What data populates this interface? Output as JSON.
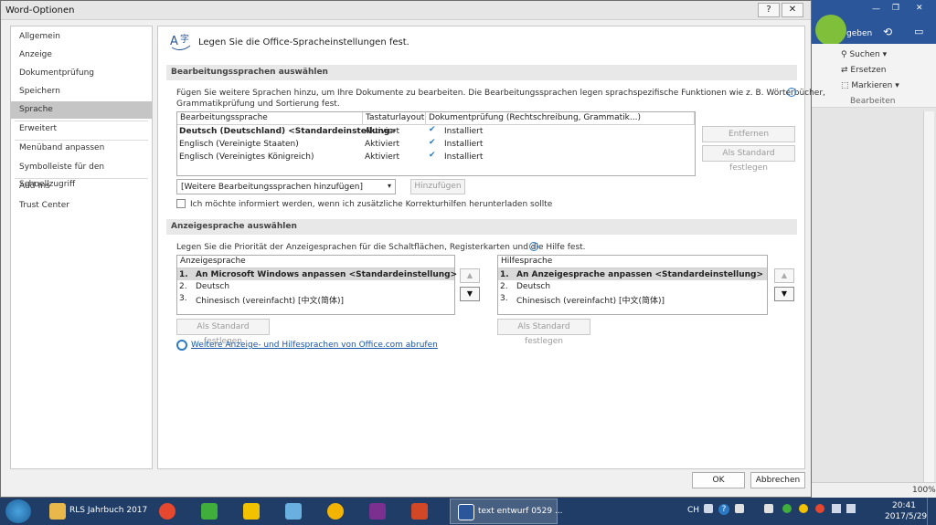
{
  "dialog": {
    "title": "Word-Optionen",
    "help_icon": "?",
    "close_icon": "✕"
  },
  "nav": {
    "items": [
      {
        "label": "Allgemein"
      },
      {
        "label": "Anzeige"
      },
      {
        "label": "Dokumentprüfung"
      },
      {
        "label": "Speichern"
      },
      {
        "label": "Sprache"
      },
      {
        "label": "Erweitert"
      },
      {
        "label": "Menüband anpassen"
      },
      {
        "label": "Symbolleiste für den Schnellzugriff"
      },
      {
        "label": "Add-Ins"
      },
      {
        "label": "Trust Center"
      }
    ],
    "selected": "Sprache"
  },
  "header": {
    "text": "Legen Sie die Office-Spracheinstellungen fest."
  },
  "editing": {
    "section_title": "Bearbeitungssprachen auswählen",
    "description_line1": "Fügen Sie weitere Sprachen hinzu, um Ihre Dokumente zu bearbeiten. Die Bearbeitungssprachen legen sprachspezifische Funktionen wie z. B. Wörterbücher,",
    "description_line2": "Grammatikprüfung und Sortierung fest.",
    "columns": [
      "Bearbeitungssprache",
      "Tastaturlayout",
      "Dokumentprüfung (Rechtschreibung, Grammatik...)"
    ],
    "rows": [
      {
        "language": "Deutsch (Deutschland) <Standardeinstellung>",
        "keyboard": "Aktiviert",
        "proofing": "Installiert"
      },
      {
        "language": "Englisch (Vereinigte Staaten)",
        "keyboard": "Aktiviert",
        "proofing": "Installiert"
      },
      {
        "language": "Englisch (Vereinigtes Königreich)",
        "keyboard": "Aktiviert",
        "proofing": "Installiert"
      }
    ],
    "remove_button": "Entfernen",
    "set_default_button": "Als Standard festlegen",
    "add_dropdown_value": "[Weitere Bearbeitungssprachen hinzufügen]",
    "add_button": "Hinzufügen",
    "notify_checkbox_label": "Ich möchte informiert werden, wenn ich zusätzliche Korrekturhilfen herunterladen sollte"
  },
  "display": {
    "section_title": "Anzeigesprache auswählen",
    "description": "Legen Sie die Priorität der Anzeigesprachen für die Schaltflächen, Registerkarten und die Hilfe fest.",
    "display_list": {
      "header": "Anzeigesprache",
      "items": [
        {
          "num": "1.",
          "label": "An Microsoft Windows anpassen <Standardeinstellung>"
        },
        {
          "num": "2.",
          "label": "Deutsch"
        },
        {
          "num": "3.",
          "label": "Chinesisch (vereinfacht) [中文(简体)]"
        }
      ]
    },
    "help_list": {
      "header": "Hilfesprache",
      "items": [
        {
          "num": "1.",
          "label": "An Anzeigesprache anpassen <Standardeinstellung>"
        },
        {
          "num": "2.",
          "label": "Deutsch"
        },
        {
          "num": "3.",
          "label": "Chinesisch (vereinfacht) [中文(简体)]"
        }
      ]
    },
    "set_default_button": "Als Standard festlegen",
    "link": "Weitere Anzeige- und Hilfesprachen von Office.com abrufen"
  },
  "footer": {
    "ok": "OK",
    "cancel": "Abbrechen"
  },
  "word_window": {
    "title_partial": "text entwurf 0529",
    "tab_partial": "geben",
    "search": "Suchen",
    "replace": "Ersetzen",
    "select": "Markieren",
    "group": "Bearbeiten",
    "zoom": "100%"
  },
  "taskbar": {
    "apps": [
      {
        "label": "RLS Jahrbuch 2017",
        "icon": "folder-icon",
        "color": "#e8b84a"
      },
      {
        "label": "",
        "icon": "chrome-icon",
        "color": "#e6472f"
      },
      {
        "label": "",
        "icon": "parrot-icon",
        "color": "#3fae3a"
      },
      {
        "label": "",
        "icon": "lightbulb-icon",
        "color": "#f2c200"
      },
      {
        "label": "",
        "icon": "paint-icon",
        "color": "#6ab0de"
      },
      {
        "label": "",
        "icon": "triangle-icon",
        "color": "#f2b400"
      },
      {
        "label": "",
        "icon": "onenote-icon",
        "color": "#7b2f8f"
      },
      {
        "label": "",
        "icon": "powerpoint-icon",
        "color": "#d24726"
      },
      {
        "label": "text entwurf 0529 ...",
        "icon": "word-icon",
        "color": "#2b579a"
      }
    ],
    "lang": "CH",
    "time": "20:41",
    "date": "2017/5/29"
  }
}
